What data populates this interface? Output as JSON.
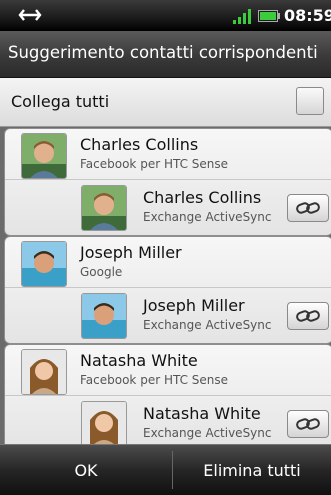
{
  "status_bar": {
    "time": "08:59",
    "icons": [
      "usb-icon",
      "signal-icon",
      "battery-icon"
    ]
  },
  "header": {
    "title": "Suggerimento contatti corrispondenti"
  },
  "link_all": {
    "label": "Collega tutti",
    "checked": false
  },
  "groups": [
    {
      "name": "Charles Collins",
      "source": "Facebook per HTC Sense",
      "match": {
        "name": "Charles Collins",
        "source": "Exchange ActiveSync"
      }
    },
    {
      "name": "Joseph Miller",
      "source": "Google",
      "match": {
        "name": "Joseph Miller",
        "source": "Exchange ActiveSync"
      }
    },
    {
      "name": "Natasha White",
      "source": "Facebook per HTC Sense",
      "match": {
        "name": "Natasha White",
        "source": "Exchange ActiveSync"
      }
    }
  ],
  "footer": {
    "ok_label": "OK",
    "delete_all_label": "Elimina tutti"
  },
  "colors": {
    "accent_green": "#3ccb3c",
    "list_background": "#6b6b6b",
    "bar_dark": "#262626"
  }
}
